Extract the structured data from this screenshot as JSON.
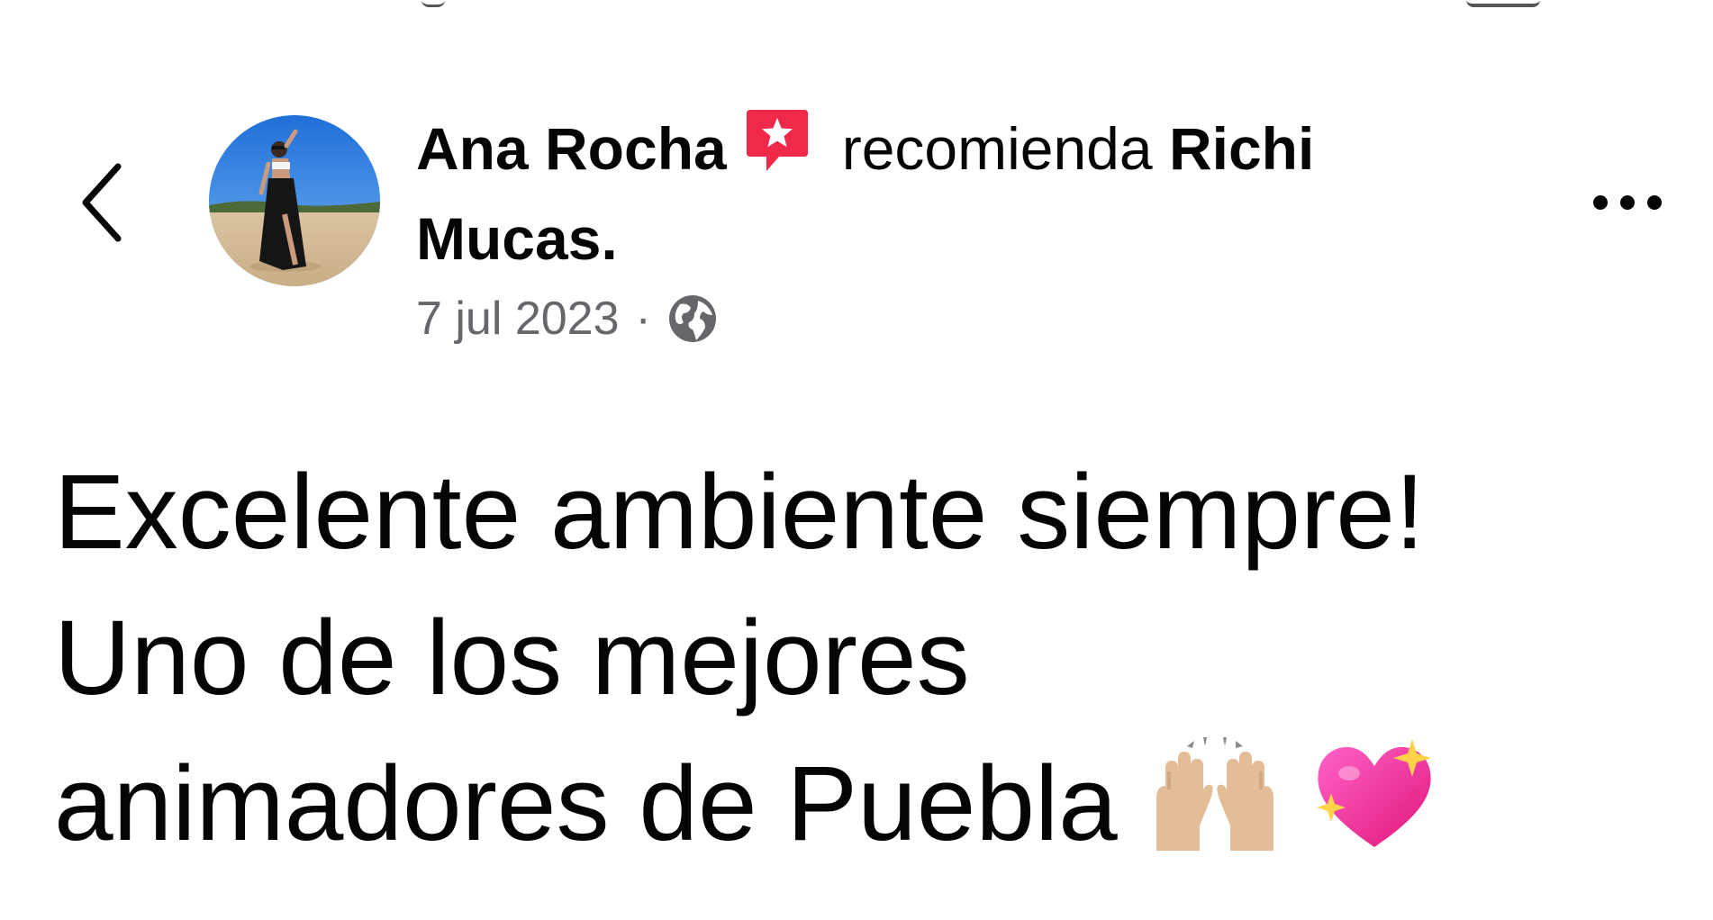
{
  "post_header": {
    "author_name": "Ana Rocha",
    "action_text": "recomienda",
    "page_name_line1": "Richi",
    "page_name_line2": "Mucas.",
    "date": "7 jul 2023",
    "separator": "·",
    "audience_icon": "globe-icon",
    "badge_icon": "recommendation-star-icon",
    "badge_color": "#f0284a"
  },
  "navigation": {
    "back_icon": "chevron-left-icon",
    "more_icon": "more-horizontal-icon"
  },
  "post": {
    "line1": "Excelente ambiente siempre!",
    "line2": "Uno de los mejores",
    "line3": "animadores de Puebla",
    "emojis": [
      "raising-hands-emoji",
      "sparkling-heart-emoji"
    ]
  }
}
